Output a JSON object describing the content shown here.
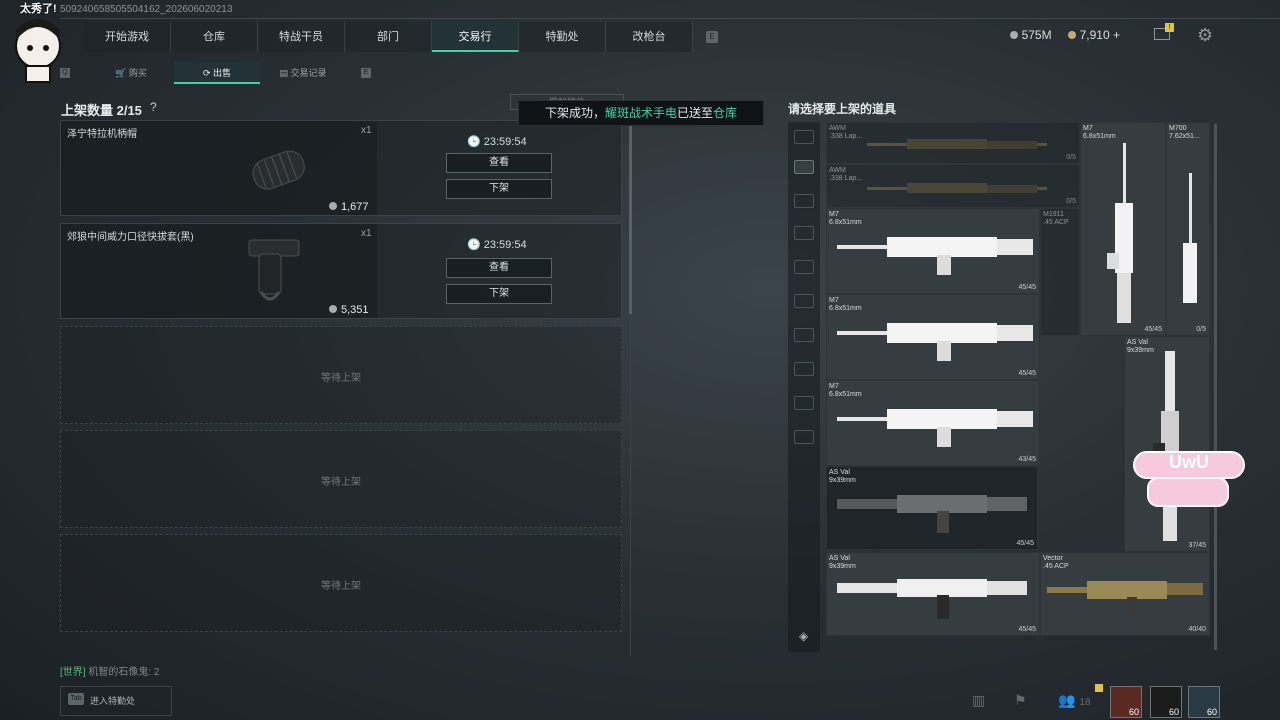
{
  "uid": "509240658505504162_202606020213",
  "nav": {
    "tabs": [
      "开始游戏",
      "仓库",
      "特战干员",
      "部门",
      "交易行",
      "特勤处",
      "改枪台"
    ],
    "active_index": 4
  },
  "currency": {
    "silver": "575M",
    "gold": "7,910",
    "plus": "+"
  },
  "mail_badge": "!",
  "subtabs": {
    "buy": "购买",
    "sell": "出售",
    "records": "交易记录",
    "key_left": "Q",
    "key_right": "E"
  },
  "listing": {
    "title": "上架数量 2/15",
    "help": "?",
    "items": [
      {
        "name": "泽宁特拉机柄帽",
        "qty": "x1",
        "timer": "23:59:54",
        "price": "1,677",
        "view": "查看",
        "remove": "下架"
      },
      {
        "name": "郊狼中间威力口径快拔套(黑)",
        "qty": "x1",
        "timer": "23:59:54",
        "price": "5,351",
        "view": "查看",
        "remove": "下架"
      }
    ],
    "empty_label": "等待上架"
  },
  "toast": {
    "under": "增加栏位",
    "prefix": "下架成功，",
    "item": "耀斑战术手电",
    "mid": "已送至",
    "dest": "仓库"
  },
  "chat": {
    "channel": "[世界]",
    "text": "机智的石像鬼: 2"
  },
  "tab_hint": {
    "key": "Tab",
    "label": "进入特勤处"
  },
  "right": {
    "title": "请选择要上架的道具",
    "items": [
      {
        "name": "AWM\n.338 Lap...",
        "dur": "0/5"
      },
      {
        "name": "AWM\n.338 Lap...",
        "dur": "0/5"
      },
      {
        "name": "M7\n6.8x51mm",
        "dur": ""
      },
      {
        "name": "M700\n7.62x51...",
        "dur": "0/5"
      },
      {
        "name": "M7\n6.8x51mm",
        "dur": "45/45"
      },
      {
        "name": "M1911\n.45 ACP",
        "dur": ""
      },
      {
        "name": "M7\n6.8x51mm",
        "dur": "45/45"
      },
      {
        "name": "M7\n6.8x51mm",
        "dur": "43/45"
      },
      {
        "name": "AS Val\n9x39mm",
        "dur": "37/45"
      },
      {
        "name": "AS Val\n9x39mm",
        "dur": "45/45"
      },
      {
        "name": "AS Val\n9x39mm",
        "dur": "45/45"
      },
      {
        "name": "Vector\n.45 ACP",
        "dur": "40/40"
      },
      {
        "name": "",
        "dur": "45/45"
      },
      {
        "name": "",
        "dur": "0/5"
      }
    ]
  },
  "bottom": {
    "friends_count": "18",
    "levels": [
      "60",
      "60",
      "60"
    ]
  },
  "overlay": {
    "streamer_text": "太秀了!",
    "uwu": "UwU"
  },
  "colors": {
    "accent": "#3fd3a2",
    "gold_badge": "#e1c244"
  }
}
